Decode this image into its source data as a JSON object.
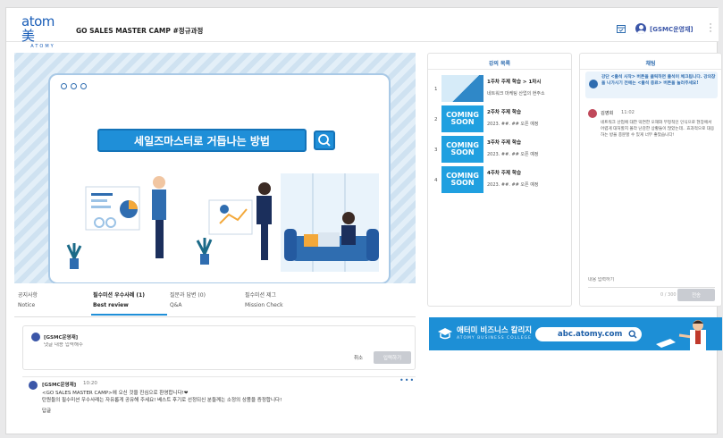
{
  "header": {
    "logo_text": "atom美",
    "logo_sub": "ATOMY",
    "title": "GO SALES MASTER CAMP #정규과정",
    "username": "[GSMC운영재]"
  },
  "video": {
    "headline": "세일즈마스터로 거듭나는 방법"
  },
  "tabs": [
    {
      "label": "공지사항",
      "sub": "Notice"
    },
    {
      "label": "필수미션 우수사례 (1)",
      "sub": "Best review"
    },
    {
      "label": "질문과 답변 (0)",
      "sub": "Q&A"
    },
    {
      "label": "필수미션 제그",
      "sub": "Mission Check"
    }
  ],
  "comment_box": {
    "user": "[GSMC운영재]",
    "placeholder": "댓글 내용 입력해주",
    "cancel": "취소",
    "submit": "입력하기"
  },
  "post": {
    "user": "[GSMC운영재]",
    "time": "10:20",
    "lines": [
      "<GO SALES MASTER CAMP>에 오신 것을 진심으로 환영합니다!❤",
      "탄원들의 필수미션 우수사례는 자유롭게 공유해 주세요! 베스트 후기로 선정되신 분들께는 소정의 상품을 증정합니다!",
      "답글"
    ]
  },
  "lectures": {
    "title": "강의 목록",
    "items": [
      {
        "num": "1",
        "thumb": "",
        "title": "1주차 주제 학습 > 1차시",
        "sub": "네트워크 마케팅 산업의 현주소"
      },
      {
        "num": "2",
        "thumb": "COMING SOON",
        "title": "2주차 주제 학습",
        "sub": "2023. ##. ## 오픈 예정"
      },
      {
        "num": "3",
        "thumb": "COMING SOON",
        "title": "3주차 주제 학습",
        "sub": "2023. ##. ## 오픈 예정"
      },
      {
        "num": "4",
        "thumb": "COMING SOON",
        "title": "4주차 주제 학습",
        "sub": "2023. ##. ## 오픈 예정"
      }
    ]
  },
  "chat": {
    "title": "채팅",
    "notice": "강단 <출석 시작> 버튼을 클릭하면 출석이 체크됩니다. 강의창을 나가시기 전에는 <출석 종료> 버튼을 눌러주세요!",
    "user": "김영희",
    "time": "11:02",
    "message": "네트워크 산업에 대한 막연한 오해와 부정적인 인식으로 현장에서 어렵게 대처할지 몰라 난감한 상황들이 많았는데.. 효과적으로 대응하는 방을 충분할 수 있게 너무 좋았습니다!",
    "placeholder": "내용 입력하기",
    "count": "0 / 300",
    "send": "전송"
  },
  "banner": {
    "title": "애터미 비즈니스 칼리지",
    "sub": "ATOMY BUSINESS COLLEGE",
    "url": "abc.atomy.com"
  },
  "colors": {
    "accent": "#1f8fd8",
    "brand": "#1a5eb8",
    "username": "#3b56a8"
  }
}
